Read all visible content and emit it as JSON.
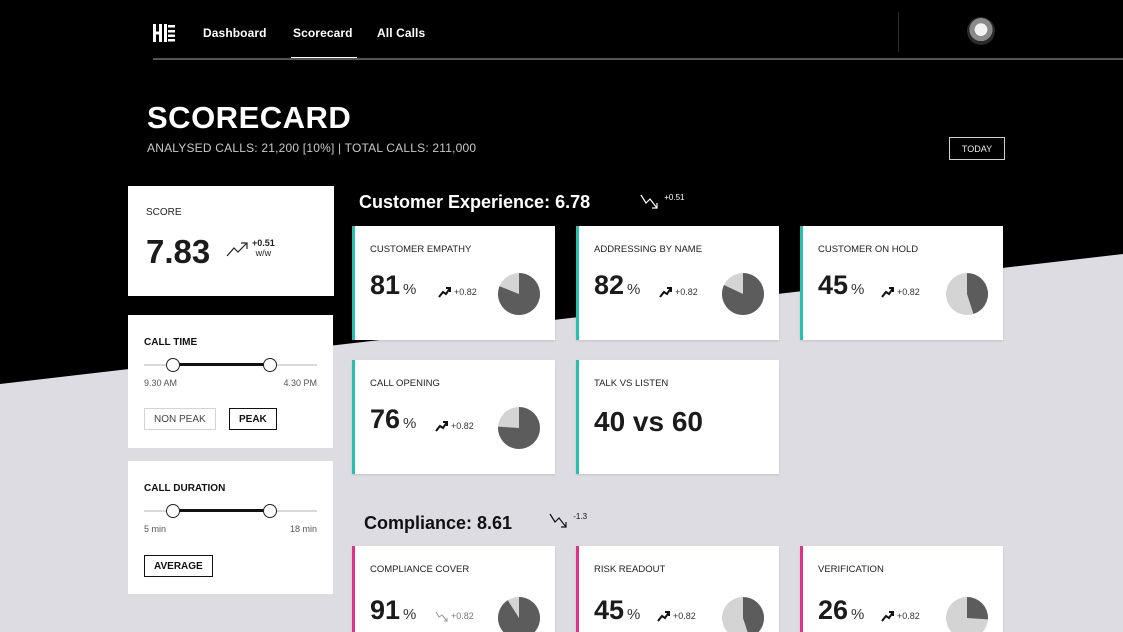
{
  "nav": {
    "items": [
      {
        "label": "Dashboard",
        "active": false
      },
      {
        "label": "Scorecard",
        "active": true
      },
      {
        "label": "All Calls",
        "active": false
      }
    ]
  },
  "header": {
    "title": "SCORECARD",
    "subtitle": "ANALYSED CALLS: 21,200 [10%]  |  TOTAL CALLS: 211,000",
    "today_label": "TODAY"
  },
  "score": {
    "label": "SCORE",
    "value": "7.83",
    "delta": "+0.51",
    "delta_unit": "w/w",
    "trend": "up"
  },
  "call_time": {
    "label": "CALL TIME",
    "min_label": "9.30 AM",
    "max_label": "4.30 PM",
    "range_start_pct": 17,
    "range_end_pct": 73,
    "options": [
      {
        "label": "NON PEAK",
        "selected": false
      },
      {
        "label": "PEAK",
        "selected": true
      }
    ]
  },
  "call_duration": {
    "label": "CALL DURATION",
    "min_label": "5 min",
    "max_label": "18 min",
    "range_start_pct": 17,
    "range_end_pct": 73,
    "option_label": "AVERAGE"
  },
  "sections": {
    "customer_experience": {
      "heading": "Customer Experience: 6.78",
      "trend_delta": "+0.51",
      "trend": "down",
      "cards": [
        {
          "label": "CUSTOMER EMPATHY",
          "value": "81",
          "unit": "%",
          "delta": "+0.82",
          "trend": "up",
          "pie_fraction": 0.81
        },
        {
          "label": "ADDRESSING BY NAME",
          "value": "82",
          "unit": "%",
          "delta": "+0.82",
          "trend": "up",
          "pie_fraction": 0.82
        },
        {
          "label": "CUSTOMER ON HOLD",
          "value": "45",
          "unit": "%",
          "delta": "+0.82",
          "trend": "up",
          "pie_fraction": 0.45
        },
        {
          "label": "CALL OPENING",
          "value": "76",
          "unit": "%",
          "delta": "+0.82",
          "trend": "up",
          "pie_fraction": 0.76
        },
        {
          "label": "TALK VS LISTEN",
          "value": "40 vs 60"
        }
      ]
    },
    "compliance": {
      "heading": "Compliance: 8.61",
      "trend_delta": "-1.3",
      "trend": "down",
      "cards": [
        {
          "label": "COMPLIANCE COVER",
          "value": "91",
          "unit": "%",
          "delta": "+0.82",
          "trend": "down",
          "pie_fraction": 0.91
        },
        {
          "label": "RISK READOUT",
          "value": "45",
          "unit": "%",
          "delta": "+0.82",
          "trend": "up",
          "pie_fraction": 0.45
        },
        {
          "label": "VERIFICATION",
          "value": "26",
          "unit": "%",
          "delta": "+0.82",
          "trend": "up",
          "pie_fraction": 0.26
        }
      ]
    }
  },
  "colors": {
    "background_dark": "#000000",
    "background_light": "#dcdce2",
    "accent_teal": "#2bbfae",
    "accent_pink": "#e2318b",
    "pie_fill": "#5c5c5c",
    "pie_rest": "#d4d4d4"
  }
}
